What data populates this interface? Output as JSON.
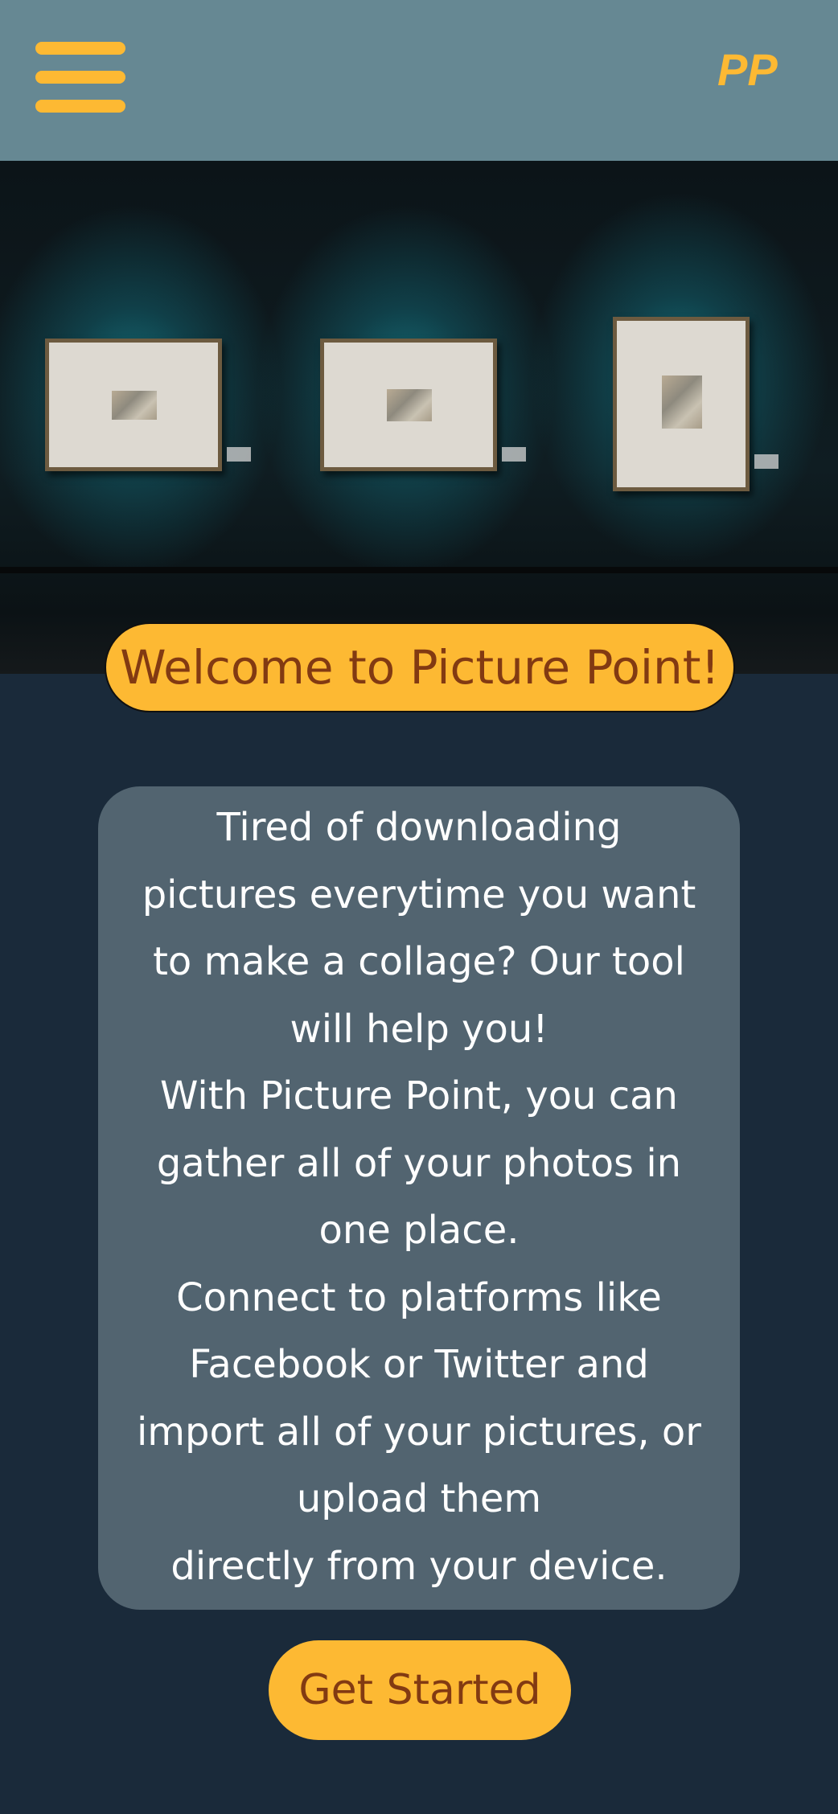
{
  "colors": {
    "header_bg": "#668893",
    "page_bg": "#1a2a3a",
    "accent": "#fdb933",
    "accent_text": "#823a12",
    "card_bg": "#526470",
    "card_text": "#ffffff"
  },
  "header": {
    "menu_icon": "hamburger-menu-icon",
    "logo_text": "PP"
  },
  "hero": {
    "image": "art-gallery-wall-with-three-framed-pictures"
  },
  "welcome": {
    "title": "Welcome to Picture Point!"
  },
  "intro": {
    "lines": [
      "Tired of downloading",
      "pictures everytime you want",
      "to make a collage? Our tool",
      "will help you!",
      "With Picture Point, you can",
      "gather all of your photos in",
      "one place.",
      "Connect to platforms like",
      "Facebook or Twitter and",
      "import all of your pictures, or",
      "upload them",
      "directly from your device."
    ]
  },
  "cta": {
    "label": "Get Started"
  }
}
